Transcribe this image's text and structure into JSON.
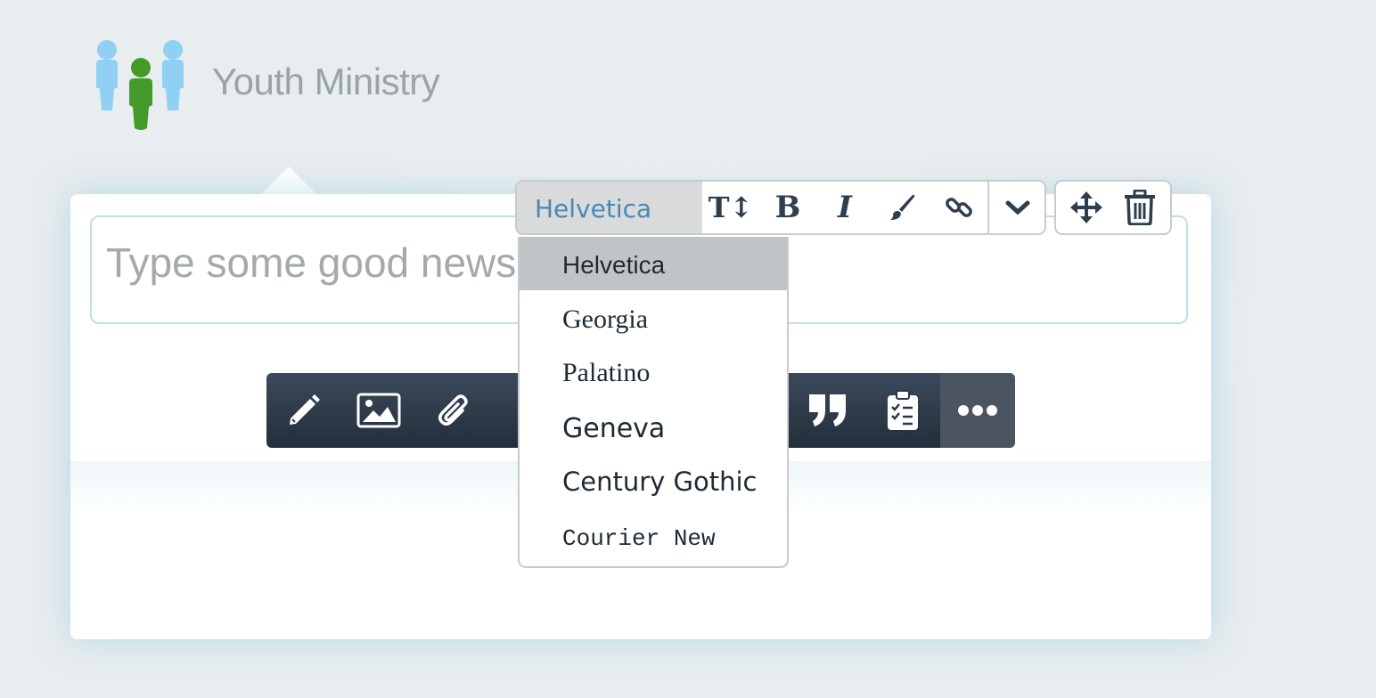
{
  "app": {
    "title": "Youth Ministry",
    "logo_icon": "three-people-logo-icon"
  },
  "composer": {
    "placeholder": "Type some good news"
  },
  "format_toolbar": {
    "font_family": "Helvetica",
    "buttons": [
      {
        "name": "text-size-icon",
        "label": "T↕"
      },
      {
        "name": "bold-icon",
        "label": "B"
      },
      {
        "name": "italic-icon",
        "label": "I"
      },
      {
        "name": "paintbrush-icon",
        "label": ""
      },
      {
        "name": "link-icon",
        "label": ""
      },
      {
        "name": "chevron-down-icon",
        "label": ""
      }
    ],
    "block_buttons": [
      {
        "name": "move-icon"
      },
      {
        "name": "trash-icon"
      }
    ]
  },
  "font_menu": {
    "selected": "Helvetica",
    "options": [
      "Helvetica",
      "Georgia",
      "Palatino",
      "Geneva",
      "Century Gothic",
      "Courier New"
    ]
  },
  "post_toolbar": {
    "buttons": [
      "pencil-icon",
      "image-icon",
      "paperclip-icon",
      "link-icon",
      "hidden",
      "hidden",
      "hidden",
      "quote-icon",
      "clipboard-checklist-icon",
      "more-icon"
    ]
  },
  "colors": {
    "accent": "#4a88b3",
    "toolbar_dark": "#2a3746",
    "logo_blue": "#8fd0f4",
    "logo_green": "#459a2a"
  }
}
